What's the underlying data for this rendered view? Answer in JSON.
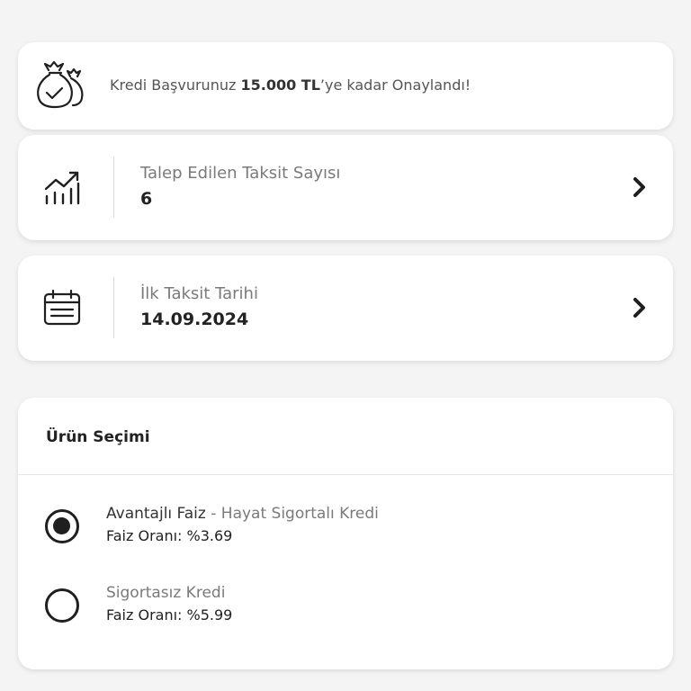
{
  "approval": {
    "prefix": "Kredi Başvurunuz ",
    "amount": "15.000 TL",
    "suffix": "’ye kadar Onaylandı!"
  },
  "installments": {
    "label": "Talep Edilen Taksit Sayısı",
    "value": "6"
  },
  "first_installment": {
    "label": "İlk Taksit Tarihi",
    "value": "14.09.2024"
  },
  "product_selection": {
    "title": "Ürün Seçimi",
    "options": [
      {
        "name": "Avantajlı Faiz",
        "separator": " - ",
        "subtitle": "Hayat Sigortalı Kredi",
        "rate": "Faiz Oranı: %3.69",
        "selected": true
      },
      {
        "name": "Sigortasız Kredi",
        "rate": "Faiz Oranı: %5.99",
        "selected": false
      }
    ]
  }
}
